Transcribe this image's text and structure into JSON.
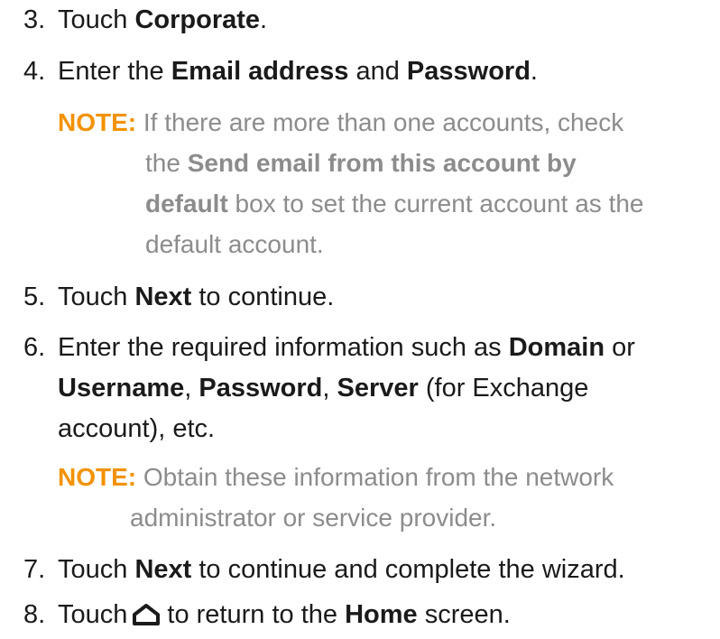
{
  "steps": {
    "s3": {
      "num": "3.",
      "t1": "Touch ",
      "b1": "Corporate",
      "t2": "."
    },
    "s4": {
      "num": "4.",
      "t1": "Enter the ",
      "b1": "Email address",
      "t2": " and ",
      "b2": "Password",
      "t3": "."
    },
    "note1": {
      "label": "NOTE:",
      "l1": " If there are more than one accounts, check",
      "l2a": "the ",
      "l2b": "Send email from this account by",
      "l3a": "default",
      "l3b": " box to set the current account as the",
      "l4": "default account."
    },
    "s5": {
      "num": "5.",
      "t1": "Touch ",
      "b1": "Next",
      "t2": " to continue."
    },
    "s6": {
      "num": "6.",
      "l1a": "Enter the required information such as ",
      "l1b": "Domain",
      "l1c": " or",
      "l2a": "Username",
      "l2b": ", ",
      "l2c": "Password",
      "l2d": ", ",
      "l2e": "Server",
      "l2f": " (for Exchange",
      "l3": "account), etc."
    },
    "note2": {
      "label": "NOTE:",
      "l1": " Obtain these information from the network",
      "l2": "administrator or service provider."
    },
    "s7": {
      "num": "7.",
      "t1": "Touch ",
      "b1": "Next",
      "t2": " to continue and complete the wizard."
    },
    "s8": {
      "num": "8.",
      "t1": "Touch",
      "t2": "to return to the ",
      "b1": "Home",
      "t3": " screen.",
      "icon": "home-icon"
    }
  },
  "colors": {
    "text": "#1a1a1a",
    "note_text": "#8c8c8c",
    "note_label": "#f39200"
  }
}
